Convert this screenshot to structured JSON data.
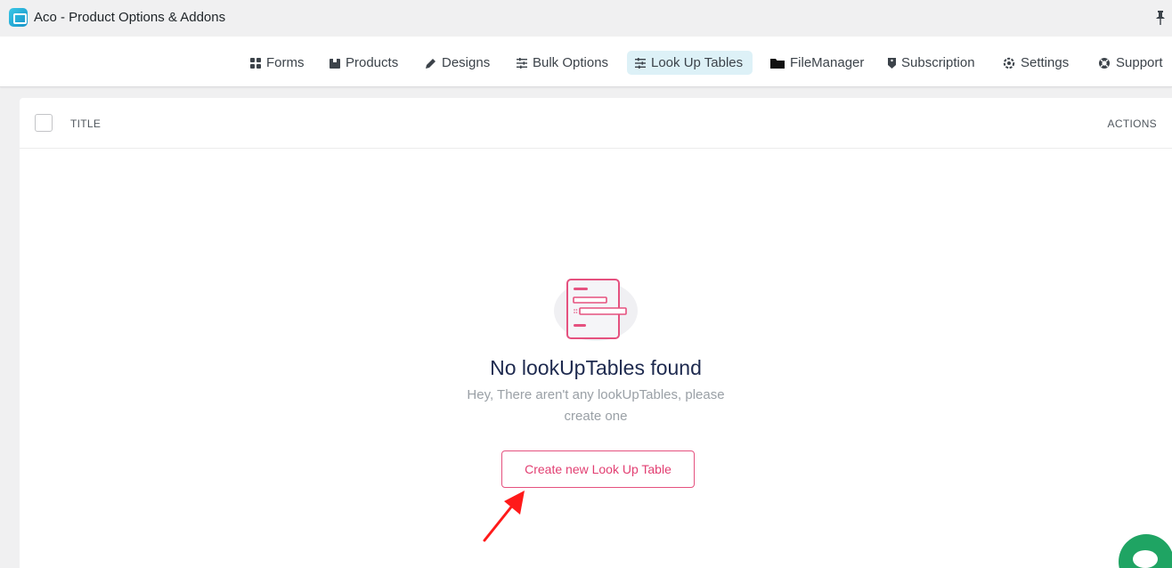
{
  "window": {
    "title": "Aco - Product Options & Addons",
    "icons": {
      "app": "app-logo-icon",
      "pin": "pin-icon"
    }
  },
  "nav": {
    "items": [
      {
        "label": "Forms",
        "icon": "grid-icon",
        "active": false
      },
      {
        "label": "Products",
        "icon": "box-icon",
        "active": false
      },
      {
        "label": "Designs",
        "icon": "pencil-icon",
        "active": false
      },
      {
        "label": "Bulk Options",
        "icon": "sliders-icon",
        "active": false
      },
      {
        "label": "Look Up Tables",
        "icon": "sliders-icon",
        "active": true
      },
      {
        "label": "FileManager",
        "icon": "folder-icon",
        "active": false
      },
      {
        "label": "Subscription",
        "icon": "tag-icon",
        "active": false
      },
      {
        "label": "Settings",
        "icon": "gear-icon",
        "active": false
      },
      {
        "label": "Support",
        "icon": "lifebuoy-icon",
        "active": false
      }
    ],
    "active_color": "#ddf1f7"
  },
  "table": {
    "columns": {
      "title": "TITLE",
      "actions": "ACTIONS"
    }
  },
  "empty_state": {
    "title": "No lookUpTables found",
    "subtitle": "Hey, There aren't any lookUpTables, please create one",
    "button_label": "Create new Look Up Table",
    "illustration": "empty-document-illustration",
    "accent_color": "#e5517f"
  },
  "annotation": {
    "icon": "red-arrow-annotation",
    "color": "#ff1a1a"
  },
  "chat": {
    "icon": "chat-bubble-icon",
    "color": "#1fa463"
  }
}
